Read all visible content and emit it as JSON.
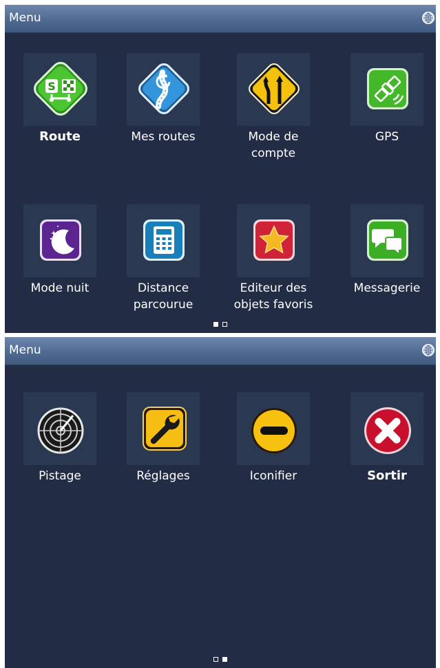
{
  "screens": [
    {
      "title": "Menu",
      "items": [
        {
          "label": "Route",
          "icon": "route-planner-icon"
        },
        {
          "label": "Mes routes",
          "icon": "my-routes-icon"
        },
        {
          "label": "Mode de\ncompte",
          "icon": "road-narrowing-sign-icon"
        },
        {
          "label": "GPS",
          "icon": "satellite-icon"
        },
        {
          "label": "Mode nuit",
          "icon": "moon-night-icon"
        },
        {
          "label": "Distance\nparcourue",
          "icon": "calculator-icon"
        },
        {
          "label": "Editeur des\nobjets favoris",
          "icon": "star-icon"
        },
        {
          "label": "Messagerie",
          "icon": "chat-bubbles-icon"
        }
      ],
      "pager": {
        "pages": 2,
        "current": 1
      }
    },
    {
      "title": "Menu",
      "items": [
        {
          "label": "Pistage",
          "icon": "radar-icon"
        },
        {
          "label": "Réglages",
          "icon": "wrench-icon"
        },
        {
          "label": "Iconifier",
          "icon": "minimize-icon"
        },
        {
          "label": "Sortir",
          "icon": "close-exit-icon"
        }
      ],
      "pager": {
        "pages": 2,
        "current": 2
      }
    }
  ],
  "colors": {
    "background": "#222d45",
    "titlebar": "#4f6a92",
    "route_green": "#3fb72a",
    "routes_blue": "#2e87c9",
    "sign_yellow": "#f4c20d",
    "night_purple": "#6a2b9a",
    "favorite_red": "#d8283a",
    "exit_red": "#c8102e"
  }
}
